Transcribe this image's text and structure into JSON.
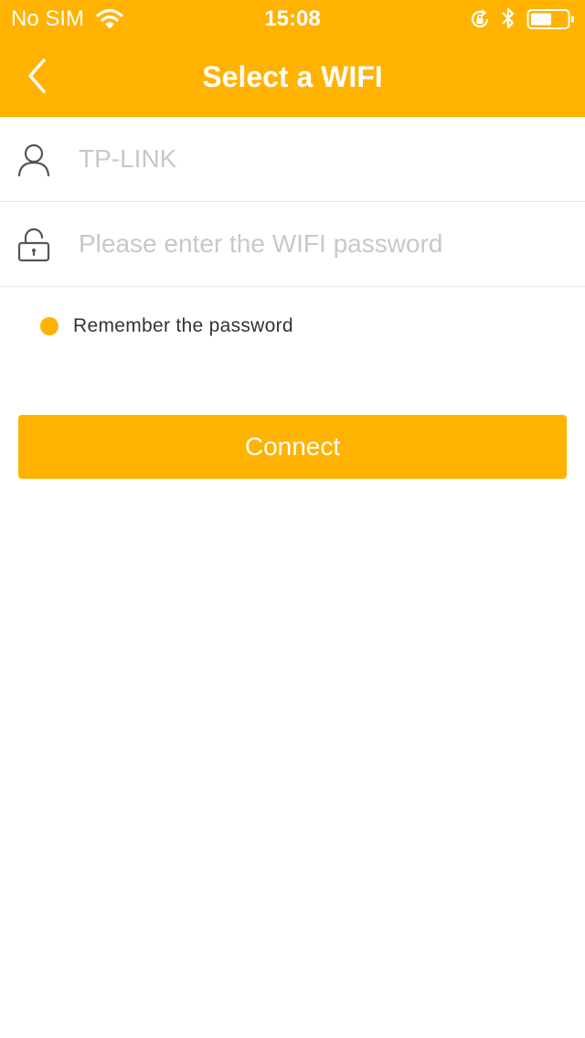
{
  "status_bar": {
    "carrier": "No SIM",
    "time": "15:08",
    "icons": [
      "wifi-icon",
      "rotation-lock-icon",
      "bluetooth-icon",
      "battery-icon"
    ]
  },
  "nav": {
    "back_icon": "chevron-left-icon",
    "title": "Select a WIFI"
  },
  "form": {
    "ssid": {
      "icon": "user-icon",
      "value": "",
      "placeholder": "TP-LINK"
    },
    "password": {
      "icon": "lock-icon",
      "value": "",
      "placeholder": "Please enter the WIFI password"
    },
    "remember": {
      "label": "Remember the password",
      "checked": true
    }
  },
  "actions": {
    "connect_label": "Connect"
  },
  "colors": {
    "accent": "#FFB300",
    "text": "#333333",
    "placeholder": "#C8C8C8",
    "divider": "#E8E8E8"
  }
}
